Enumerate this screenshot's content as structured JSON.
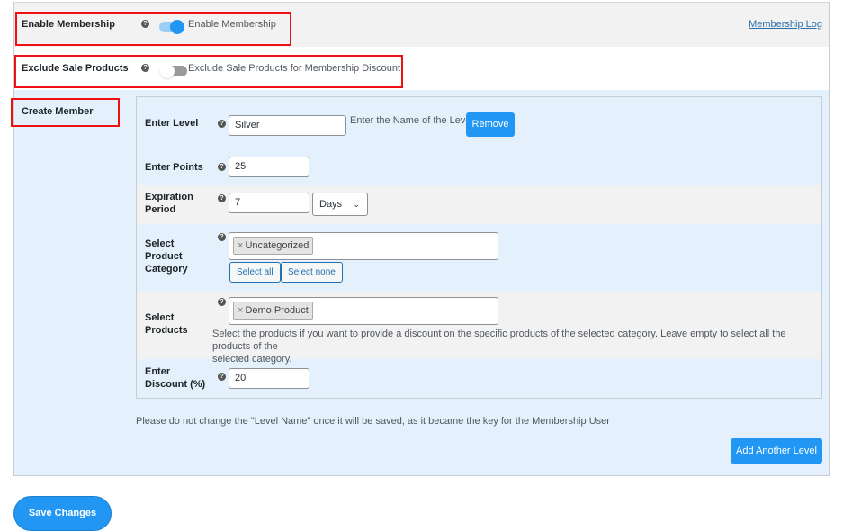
{
  "settings": {
    "enable_membership": {
      "label": "Enable Membership",
      "toggle_on": true,
      "description": "Enable Membership",
      "help_icon": "question-circle-icon"
    },
    "membership_log_link": "Membership Log",
    "exclude_sale_products": {
      "label": "Exclude Sale Products",
      "toggle_on": false,
      "description": "Exclude Sale Products for Membership Discount",
      "help_icon": "question-circle-icon"
    },
    "create_member": {
      "label": "Create Member"
    }
  },
  "level": {
    "enter_level": {
      "label": "Enter Level",
      "value": "Silver",
      "description": "Enter the Name of the Level",
      "remove_label": "Remove"
    },
    "enter_points": {
      "label": "Enter Points",
      "value": "25"
    },
    "expiration_period": {
      "label_line1": "Expiration",
      "label_line2": "Period",
      "value": "7",
      "unit_selected": "Days"
    },
    "product_category": {
      "label_line1": "Select",
      "label_line2": "Product",
      "label_line3": "Category",
      "selected": [
        "Uncategorized"
      ],
      "select_all_label": "Select all",
      "select_none_label": "Select none"
    },
    "products": {
      "label_line1": "Select",
      "label_line2": "Products",
      "selected": [
        "Demo Product"
      ],
      "description_line1": "Select the products if you want to provide a discount on the specific products of the selected category. Leave empty to select all the products of the",
      "description_line2": "selected category."
    },
    "discount": {
      "label_line1": "Enter",
      "label_line2": "Discount (%)",
      "value": "20"
    }
  },
  "notice": "Please do not change the \"Level Name\" once it will be saved, as it became the key for the Membership User",
  "add_level_label": "Add Another Level",
  "save_label": "Save Changes",
  "chip_remove_glyph": "×",
  "help_glyph": "?",
  "chevron_glyph": "⌄",
  "colors": {
    "accent": "#2196f3",
    "highlight_border": "#ee1111",
    "panel_bg": "#e4f1fc",
    "row_gray": "#f2f2f2",
    "link": "#2a6fa8"
  }
}
